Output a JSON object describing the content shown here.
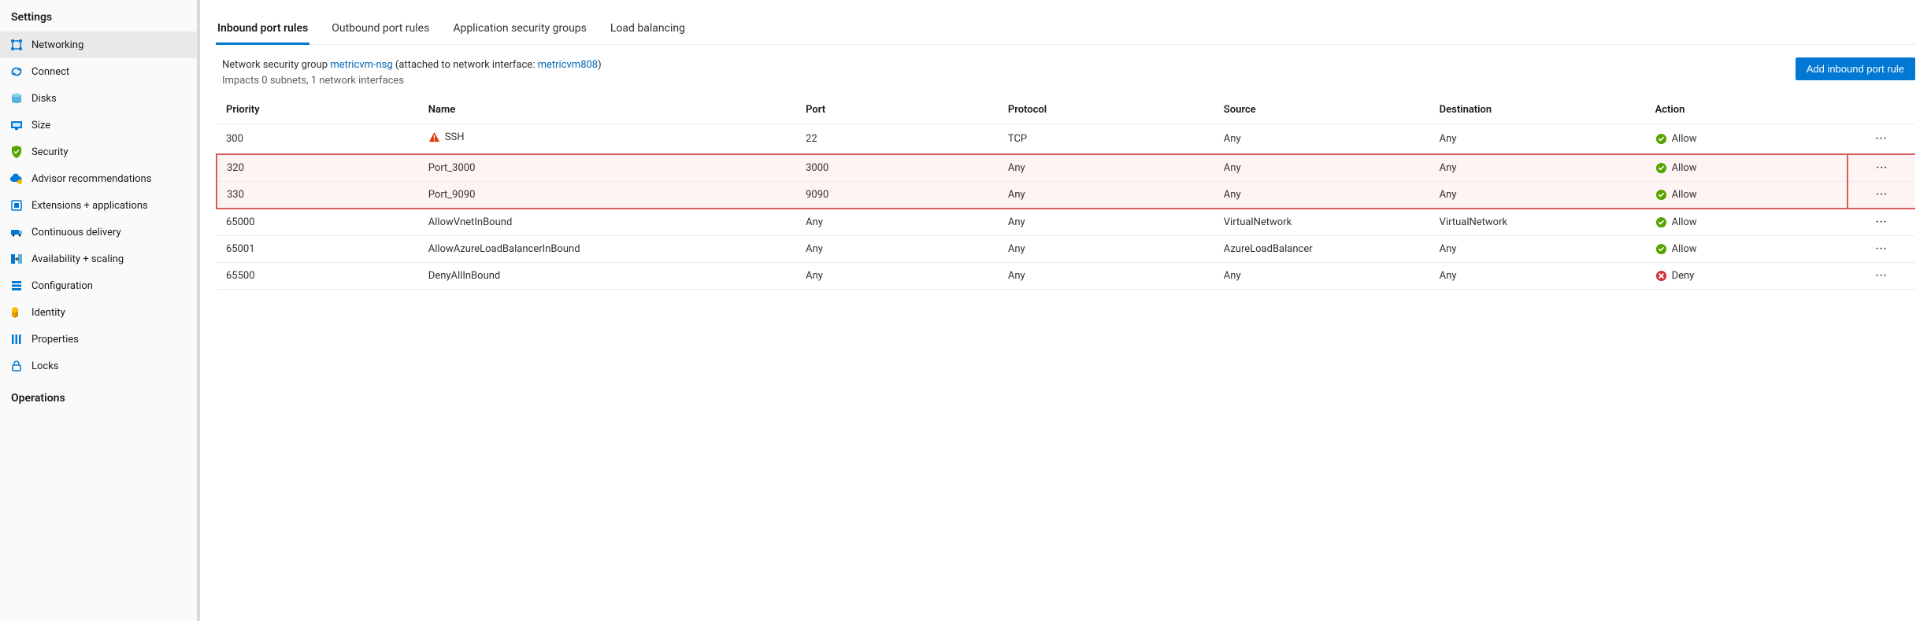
{
  "sidebar": {
    "title": "Settings",
    "items": [
      {
        "label": "Networking",
        "icon": "network",
        "active": true
      },
      {
        "label": "Connect",
        "icon": "connect"
      },
      {
        "label": "Disks",
        "icon": "disks"
      },
      {
        "label": "Size",
        "icon": "size"
      },
      {
        "label": "Security",
        "icon": "security"
      },
      {
        "label": "Advisor recommendations",
        "icon": "advisor"
      },
      {
        "label": "Extensions + applications",
        "icon": "extensions"
      },
      {
        "label": "Continuous delivery",
        "icon": "delivery"
      },
      {
        "label": "Availability + scaling",
        "icon": "availability"
      },
      {
        "label": "Configuration",
        "icon": "configuration"
      },
      {
        "label": "Identity",
        "icon": "identity"
      },
      {
        "label": "Properties",
        "icon": "properties"
      },
      {
        "label": "Locks",
        "icon": "locks"
      }
    ],
    "next_section": "Operations"
  },
  "main": {
    "tabs": [
      {
        "label": "Inbound port rules",
        "active": true
      },
      {
        "label": "Outbound port rules"
      },
      {
        "label": "Application security groups"
      },
      {
        "label": "Load balancing"
      }
    ],
    "info": {
      "prefix": "Network security group ",
      "nsg_link": "metricvm-nsg",
      "middle": " (attached to network interface: ",
      "iface_link": "metricvm808",
      "suffix": ")",
      "impacts": "Impacts 0 subnets, 1 network interfaces"
    },
    "add_button": "Add inbound port rule",
    "table": {
      "headers": [
        "Priority",
        "Name",
        "Port",
        "Protocol",
        "Source",
        "Destination",
        "Action"
      ],
      "rows": [
        {
          "priority": "300",
          "name": "SSH",
          "name_icon": "warning",
          "port": "22",
          "protocol": "TCP",
          "source": "Any",
          "destination": "Any",
          "action": "Allow",
          "action_icon": "allow"
        },
        {
          "priority": "320",
          "name": "Port_3000",
          "port": "3000",
          "protocol": "Any",
          "source": "Any",
          "destination": "Any",
          "action": "Allow",
          "action_icon": "allow",
          "highlight": true
        },
        {
          "priority": "330",
          "name": "Port_9090",
          "port": "9090",
          "protocol": "Any",
          "source": "Any",
          "destination": "Any",
          "action": "Allow",
          "action_icon": "allow",
          "highlight": true
        },
        {
          "priority": "65000",
          "name": "AllowVnetInBound",
          "port": "Any",
          "protocol": "Any",
          "source": "VirtualNetwork",
          "destination": "VirtualNetwork",
          "action": "Allow",
          "action_icon": "allow"
        },
        {
          "priority": "65001",
          "name": "AllowAzureLoadBalancerInBound",
          "port": "Any",
          "protocol": "Any",
          "source": "AzureLoadBalancer",
          "destination": "Any",
          "action": "Allow",
          "action_icon": "allow"
        },
        {
          "priority": "65500",
          "name": "DenyAllInBound",
          "port": "Any",
          "protocol": "Any",
          "source": "Any",
          "destination": "Any",
          "action": "Deny",
          "action_icon": "deny"
        }
      ]
    }
  }
}
